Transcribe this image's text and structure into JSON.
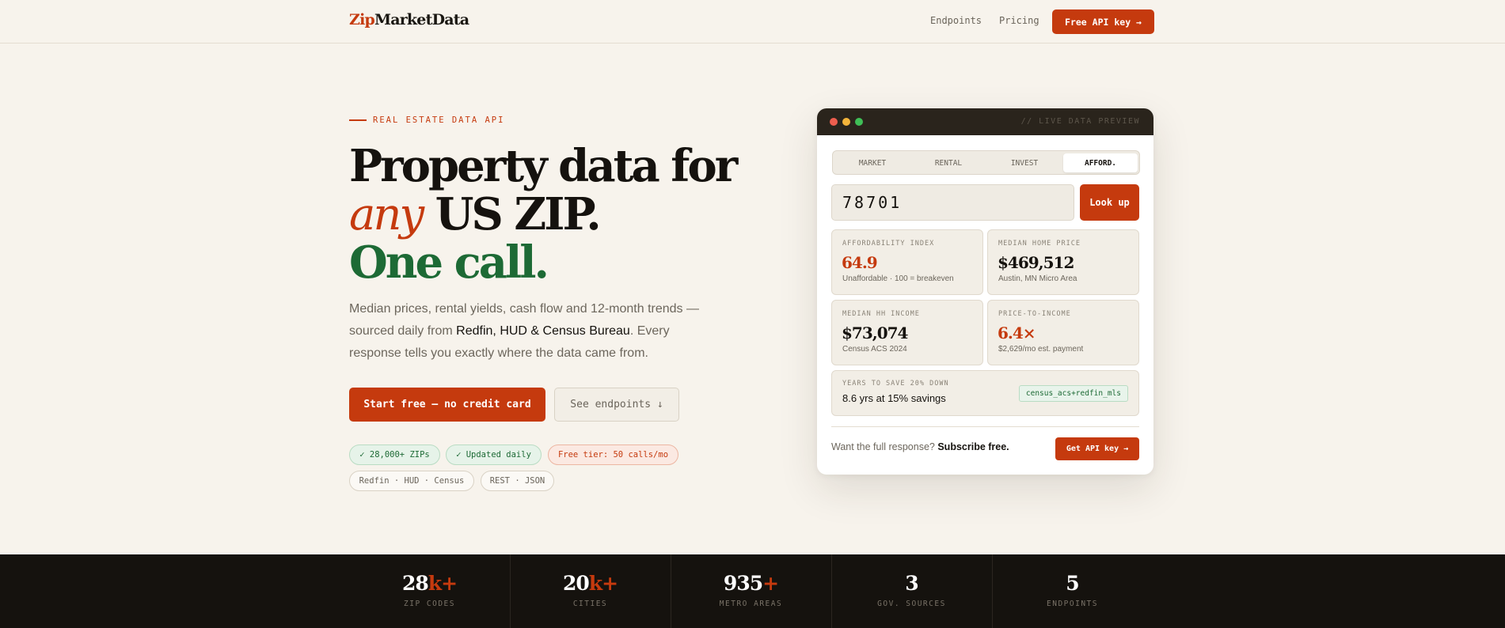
{
  "header": {
    "logo_prefix": "Zip",
    "logo_suffix": "MarketData",
    "nav": [
      "Endpoints",
      "Pricing"
    ],
    "cta_label": "Free API key →"
  },
  "hero": {
    "eyebrow": "REAL ESTATE DATA API",
    "title_line1": "Property data for",
    "title_any": "any",
    "title_line2_rest": " US ZIP.",
    "title_line3": "One call.",
    "subtitle_part1": "Median prices, rental yields, cash flow and 12-month trends — sourced daily from ",
    "subtitle_highlight": "Redfin, HUD & Census Bureau",
    "subtitle_part2": ". Every response tells you exactly where the data came from.",
    "cta_primary": "Start free — no credit card",
    "cta_secondary": "See endpoints ↓",
    "badges": [
      "✓ 28,000+ ZIPs",
      "✓ Updated daily",
      "Free tier: 50 calls/mo",
      "Redfin · HUD · Census",
      "REST · JSON"
    ]
  },
  "preview": {
    "bar_label": "// LIVE DATA PREVIEW",
    "dot_colors": [
      "#ee5e4e",
      "#f3b43b",
      "#3fbf57"
    ],
    "tabs": [
      "MARKET",
      "RENTAL",
      "INVEST",
      "AFFORD."
    ],
    "active_tab": "AFFORD.",
    "zip_value": "78701",
    "lookup_label": "Look up",
    "stats": [
      {
        "label": "AFFORDABILITY INDEX",
        "value": "64.9",
        "note": "Unaffordable · 100 = breakeven"
      },
      {
        "label": "MEDIAN HOME PRICE",
        "value": "$469,512",
        "note": "Austin, MN Micro Area"
      },
      {
        "label": "MEDIAN HH INCOME",
        "value": "$73,074",
        "note": "Census ACS 2024"
      },
      {
        "label": "PRICE-TO-INCOME",
        "value": "6.4×",
        "note": "$2,629/mo est. payment"
      }
    ],
    "savings": {
      "label": "YEARS TO SAVE 20% DOWN",
      "text": "8.6 yrs at 15% savings",
      "source": "census_acs+redfin_mls"
    },
    "footer_text": "Want the full response? ",
    "footer_bold": "Subscribe free.",
    "footer_button": "Get API key →"
  },
  "band": [
    {
      "num": "28",
      "suffix": "k+",
      "label": "ZIP CODES"
    },
    {
      "num": "20",
      "suffix": "k+",
      "label": "CITIES"
    },
    {
      "num": "935",
      "suffix": "+",
      "label": "METRO AREAS"
    },
    {
      "num": "3",
      "suffix": "",
      "label": "GOV. SOURCES"
    },
    {
      "num": "5",
      "suffix": "",
      "label": "ENDPOINTS"
    }
  ],
  "colors": {
    "accent": "#c53a0e",
    "green": "#1d6a35",
    "background": "#f7f3ec",
    "dark": "#15120e"
  }
}
